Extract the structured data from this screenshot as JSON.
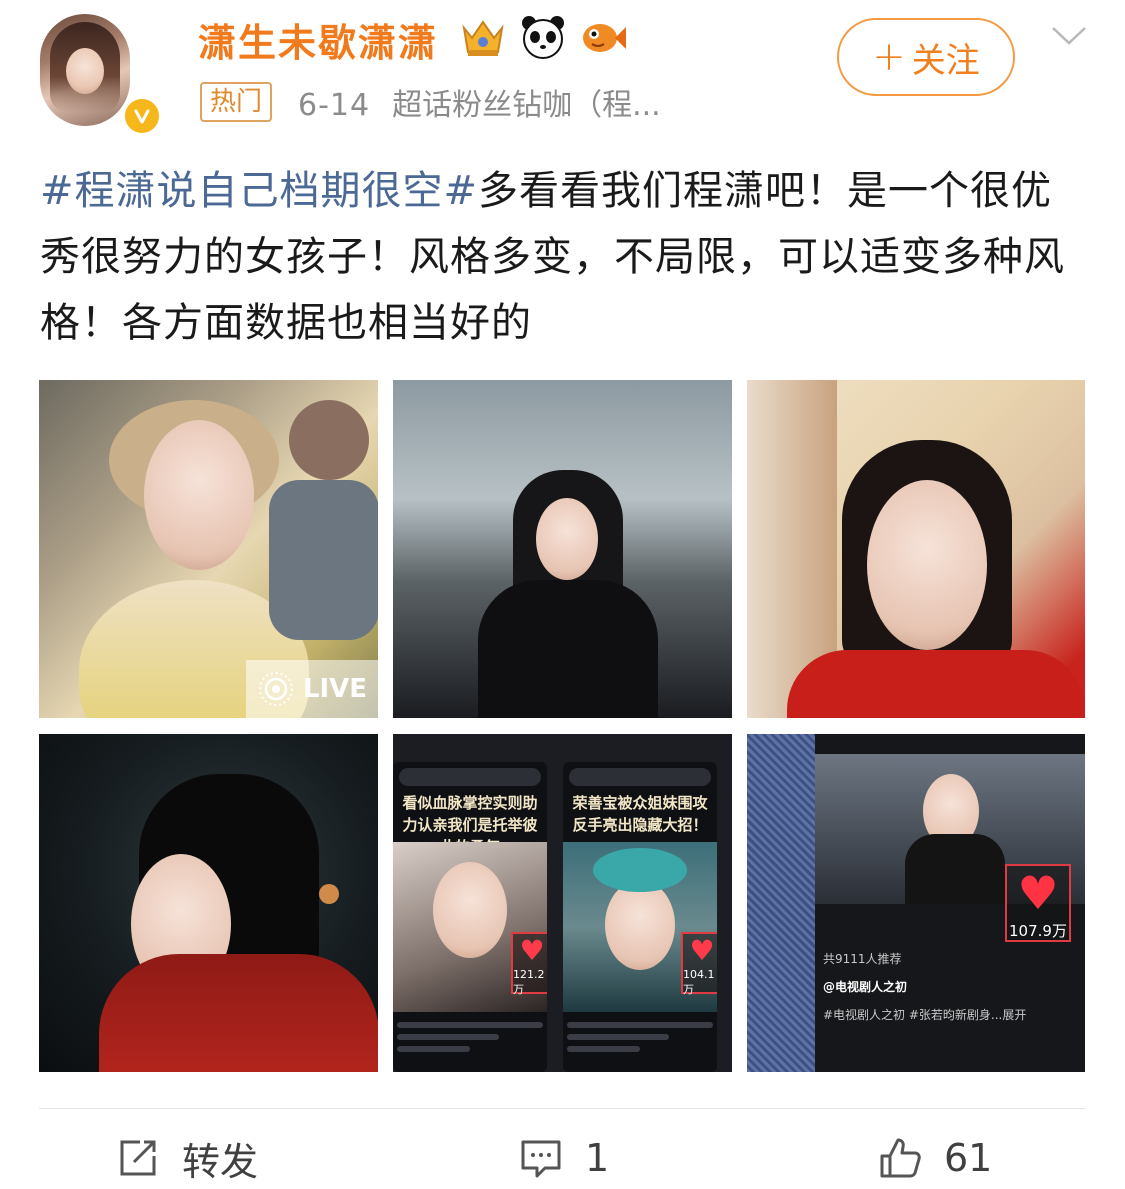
{
  "user": {
    "name": "潇生未歇潇潇",
    "verified_icon": "verified-badge-icon",
    "emblems": [
      "crown-emblem-icon",
      "panda-emblem-icon",
      "fish-emblem-icon"
    ]
  },
  "post_meta": {
    "hot_label": "热门",
    "date": "6-14",
    "source": "超话粉丝钻咖（程..."
  },
  "follow_button": {
    "plus": "+",
    "label": "关注"
  },
  "post": {
    "hashtag": "#程潇说自己档期很空#",
    "text": "多看看我们程潇吧！是一个很优秀很努力的女孩子！风格多变，不局限，可以适变多种风格！各方面数据也相当好的"
  },
  "images": {
    "live_label": "LIVE",
    "p5": {
      "left_title": "看似血脉掌控实则助力认亲我们是托举彼此的勇气",
      "left_count": "121.2万",
      "right_title": "荣善宝被众姐妹围攻反手亮出隐藏大招！",
      "right_count": "104.1万"
    },
    "p6": {
      "count": "107.9万",
      "caption_1": "共9111人推荐",
      "caption_2": "@电视剧人之初",
      "caption_3": "#电视剧人之初 #张若昀新剧身...展开"
    }
  },
  "actions": {
    "repost_label": "转发",
    "comment_count": "1",
    "like_count": "61"
  },
  "colors": {
    "username": "#f07a1c",
    "hashtag": "#4c6996",
    "follow": "#f0801e"
  }
}
